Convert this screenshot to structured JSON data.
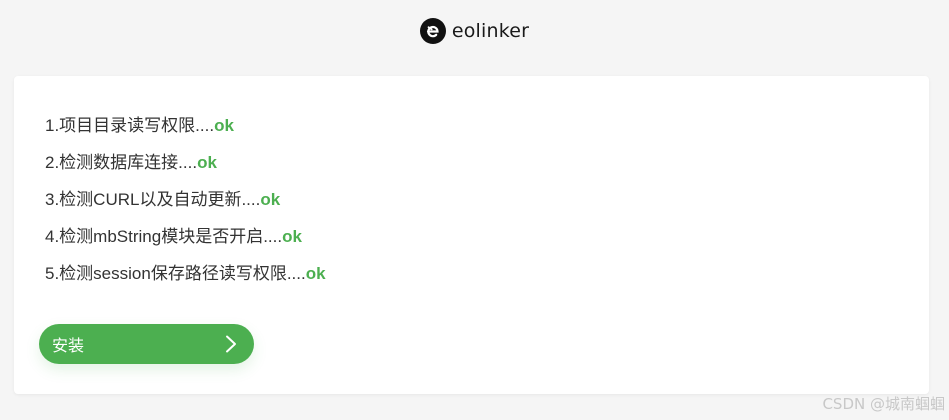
{
  "header": {
    "logo_icon": "eolinker-logo-icon",
    "logo_text": "eolinker"
  },
  "checks": [
    {
      "label": "1.项目目录读写权限....",
      "status": "ok"
    },
    {
      "label": "2.检测数据库连接....",
      "status": "ok"
    },
    {
      "label": "3.检测CURL以及自动更新....",
      "status": "ok"
    },
    {
      "label": "4.检测mbString模块是否开启....",
      "status": "ok"
    },
    {
      "label": "5.检测session保存路径读写权限....",
      "status": "ok"
    }
  ],
  "install_button": {
    "label": "安装",
    "icon": "chevron-right-icon"
  },
  "watermark": "CSDN @城南蝈蝈",
  "colors": {
    "accent": "#4caf50",
    "background": "#f5f5f5",
    "card": "#ffffff",
    "text": "#333333"
  }
}
